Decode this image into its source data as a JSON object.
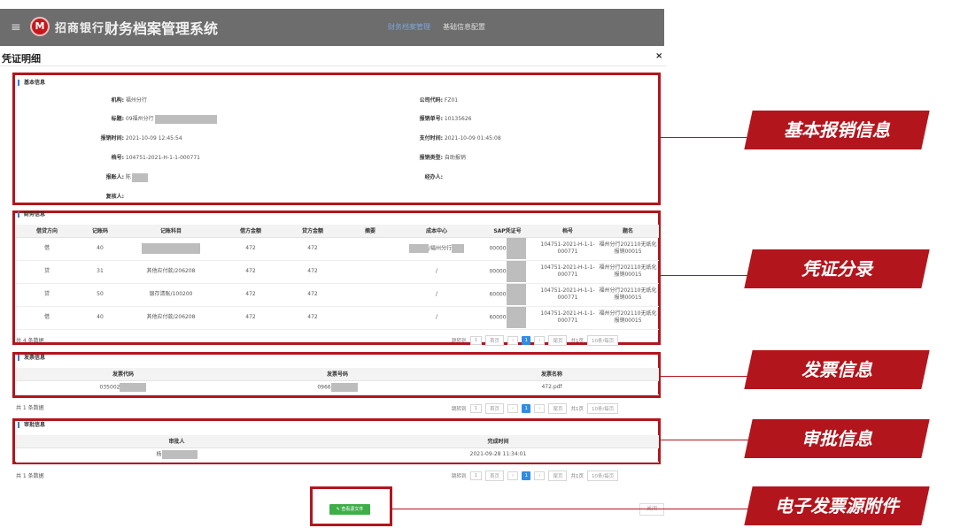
{
  "header": {
    "bank_name": "招商银行",
    "system_name": "财务档案管理系统",
    "nav": [
      "财务档案管理",
      "基础信息配置"
    ]
  },
  "modal": {
    "title": "凭证明细",
    "close": "×"
  },
  "basic": {
    "section": "基本信息",
    "left": [
      {
        "label": "机构:",
        "value": "福州分行"
      },
      {
        "label": "标题:",
        "value": "09福州分行"
      },
      {
        "label": "报销时间:",
        "value": "2021-10-09 12:45:54"
      },
      {
        "label": "档号:",
        "value": "104751-2021-H-1-1-000771"
      },
      {
        "label": "报账人:",
        "value": "陈"
      },
      {
        "label": "复核人:",
        "value": ""
      }
    ],
    "right": [
      {
        "label": "公司代码:",
        "value": "FZ01"
      },
      {
        "label": "报销单号:",
        "value": "10135626"
      },
      {
        "label": "支付时间:",
        "value": "2021-10-09 01:45:08"
      },
      {
        "label": "报销类型:",
        "value": "自助报销"
      },
      {
        "label": "经办人:",
        "value": ""
      }
    ]
  },
  "entries": {
    "section": "财务信息",
    "headers": [
      "借贷方向",
      "记账码",
      "记账科目",
      "借方金额",
      "贷方金额",
      "摘要",
      "成本中心",
      "SAP凭证号",
      "档号",
      "题名"
    ],
    "rows": [
      [
        "借",
        "40",
        "",
        "472",
        "472",
        "",
        "/福州分行",
        "00000",
        "104751-2021-H-1-1-000771",
        "福州分行202110无纸化报销00015"
      ],
      [
        "贷",
        "31",
        "其他应付款/206208",
        "472",
        "472",
        "",
        "/",
        "00000",
        "104751-2021-H-1-1-000771",
        "福州分行202110无纸化报销00015"
      ],
      [
        "贷",
        "50",
        "银存清账/100200",
        "472",
        "472",
        "",
        "/",
        "60000",
        "104751-2021-H-1-1-000771",
        "福州分行202110无纸化报销00015"
      ],
      [
        "借",
        "40",
        "其他应付款/206208",
        "472",
        "472",
        "",
        "/",
        "60000",
        "104751-2021-H-1-1-000771",
        "福州分行202110无纸化报销00015"
      ]
    ],
    "count": "共 4 条数据"
  },
  "invoice": {
    "section": "发票信息",
    "headers": [
      "发票代码",
      "发票号码",
      "发票名称"
    ],
    "row": [
      "035002",
      "0966",
      "472.pdf"
    ],
    "count": "共 1 条数据"
  },
  "approval": {
    "section": "审批信息",
    "headers": [
      "审批人",
      "完成时间"
    ],
    "row": [
      "杨",
      "2021-09-28 11:34:01"
    ],
    "count": "共 1 条数据"
  },
  "pager": {
    "jump": "跳转到",
    "jump_value": "1",
    "first": "首页",
    "prev": "‹",
    "current": "1",
    "next": "›",
    "last": "尾页",
    "total_pages": "共1页",
    "per_page": "10条/每页"
  },
  "footer": {
    "attach_button": "✎ 查看源文件",
    "close_button": "关闭"
  },
  "callouts": [
    "基本报销信息",
    "凭证分录",
    "发票信息",
    "审批信息",
    "电子发票源附件"
  ],
  "colors": {
    "accent": "#b3151d",
    "primary": "#2f8de4",
    "green": "#3fae49"
  }
}
